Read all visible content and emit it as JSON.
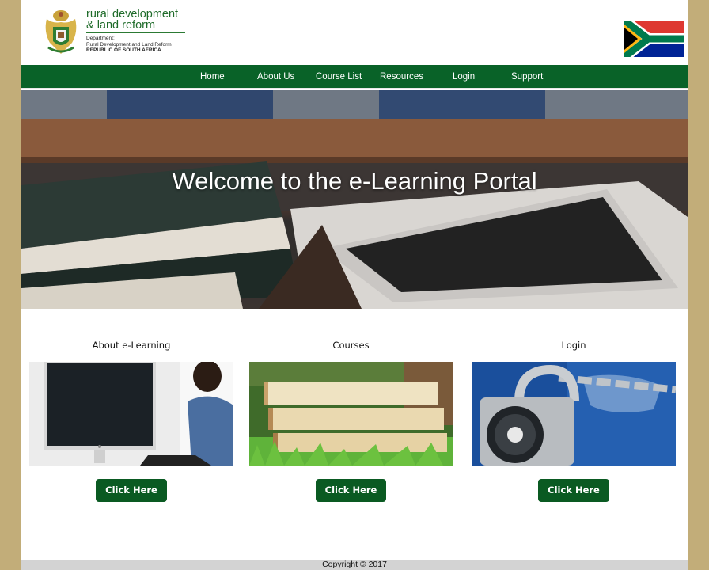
{
  "header": {
    "logo_line1": "rural development",
    "logo_line2": "& land reform",
    "dept_label": "Department:",
    "dept_name": "Rural Development and Land Reform",
    "country": "REPUBLIC OF SOUTH AFRICA"
  },
  "nav": {
    "items": [
      {
        "label": "Home"
      },
      {
        "label": "About Us"
      },
      {
        "label": "Course List"
      },
      {
        "label": "Resources"
      },
      {
        "label": "Login"
      },
      {
        "label": "Support"
      }
    ]
  },
  "hero": {
    "title": "Welcome to the e-Learning Portal"
  },
  "cards": [
    {
      "title": "About e-Learning",
      "button": "Click Here"
    },
    {
      "title": "Courses",
      "button": "Click Here"
    },
    {
      "title": "Login",
      "button": "Click Here"
    }
  ],
  "footer": {
    "copyright": "Copyright © 2017"
  },
  "colors": {
    "brand_green": "#096228",
    "button_green": "#0a5a22",
    "side_background": "#c2ad79"
  }
}
